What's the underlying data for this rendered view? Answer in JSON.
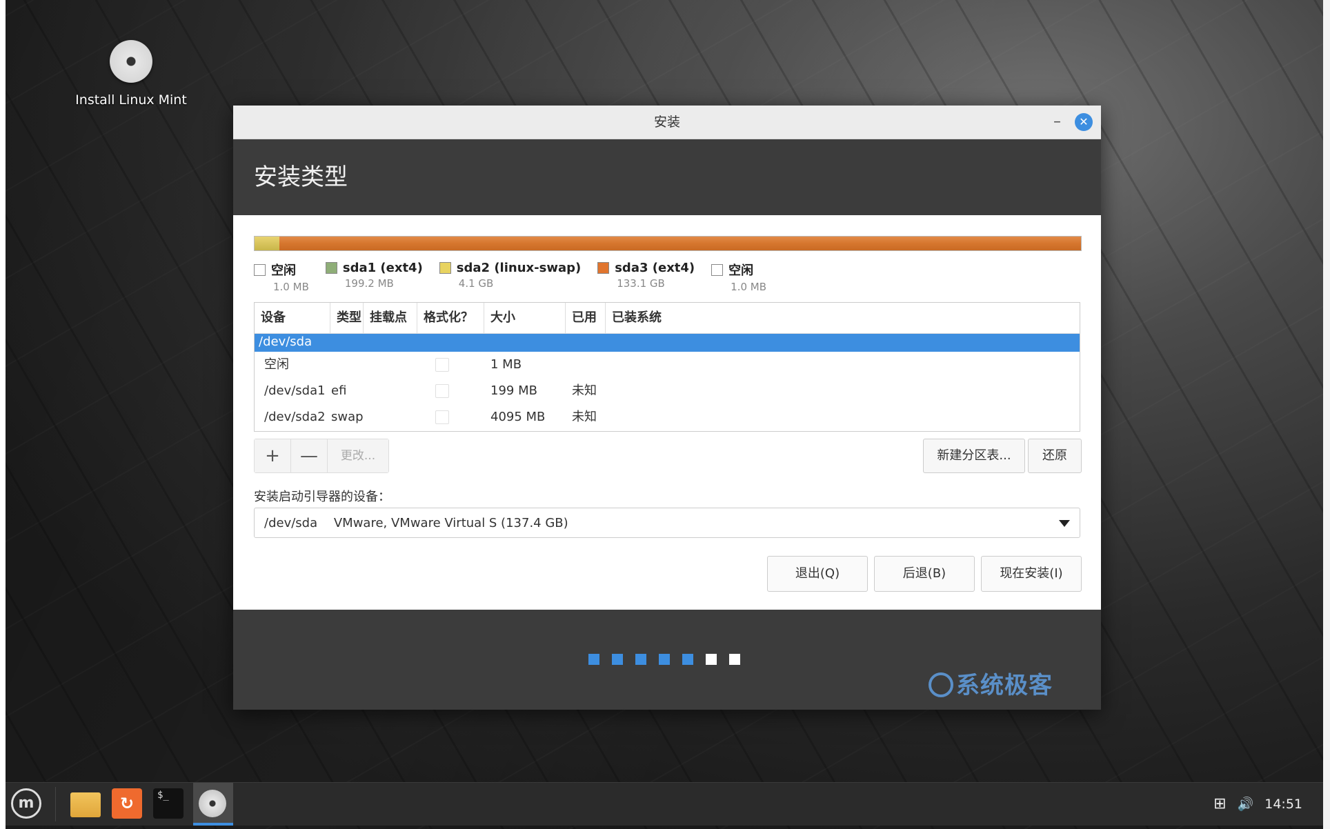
{
  "desktop": {
    "icon_label": "Install Linux Mint"
  },
  "window": {
    "title": "安装",
    "minimize_glyph": "–",
    "close_glyph": "✕",
    "header_title": "安装类型"
  },
  "partition_bar": {
    "legend": [
      {
        "name": "空闲",
        "size": "1.0 MB",
        "color": "#ffffff"
      },
      {
        "name": "sda1 (ext4)",
        "size": "199.2 MB",
        "color": "#8fae78"
      },
      {
        "name": "sda2 (linux-swap)",
        "size": "4.1 GB",
        "color": "#e8d360"
      },
      {
        "name": "sda3 (ext4)",
        "size": "133.1 GB",
        "color": "#e0752e"
      },
      {
        "name": "空闲",
        "size": "1.0 MB",
        "color": "#ffffff"
      }
    ]
  },
  "table": {
    "headers": [
      "设备",
      "类型",
      "挂载点",
      "格式化？",
      "大小",
      "已用",
      "已装系统"
    ],
    "selected_row": "/dev/sda",
    "rows": [
      {
        "device": "空闲",
        "type": "",
        "mount": "",
        "size": "1 MB",
        "used": "",
        "system": ""
      },
      {
        "device": "/dev/sda1",
        "type": "efi",
        "mount": "",
        "size": "199 MB",
        "used": "未知",
        "system": ""
      },
      {
        "device": "/dev/sda2",
        "type": "swap",
        "mount": "",
        "size": "4095 MB",
        "used": "未知",
        "system": ""
      }
    ]
  },
  "toolbar": {
    "add": "+",
    "remove": "—",
    "change": "更改...",
    "new_table": "新建分区表...",
    "revert": "还原"
  },
  "boot": {
    "label": "安装启动引导器的设备：",
    "device": "/dev/sda",
    "description": "VMware, VMware Virtual S (137.4 GB)"
  },
  "actions": {
    "quit": "退出(Q)",
    "back": "后退(B)",
    "install": "现在安装(I)"
  },
  "progress": {
    "total_steps": 7,
    "completed_steps": 5,
    "active_color": "#3d8ee0",
    "inactive_color": "#ffffff"
  },
  "watermark": "系统极客",
  "taskbar": {
    "menu_icon": "linux-mint-logo-icon",
    "terminal_text": "$_",
    "clock": "14:51"
  }
}
